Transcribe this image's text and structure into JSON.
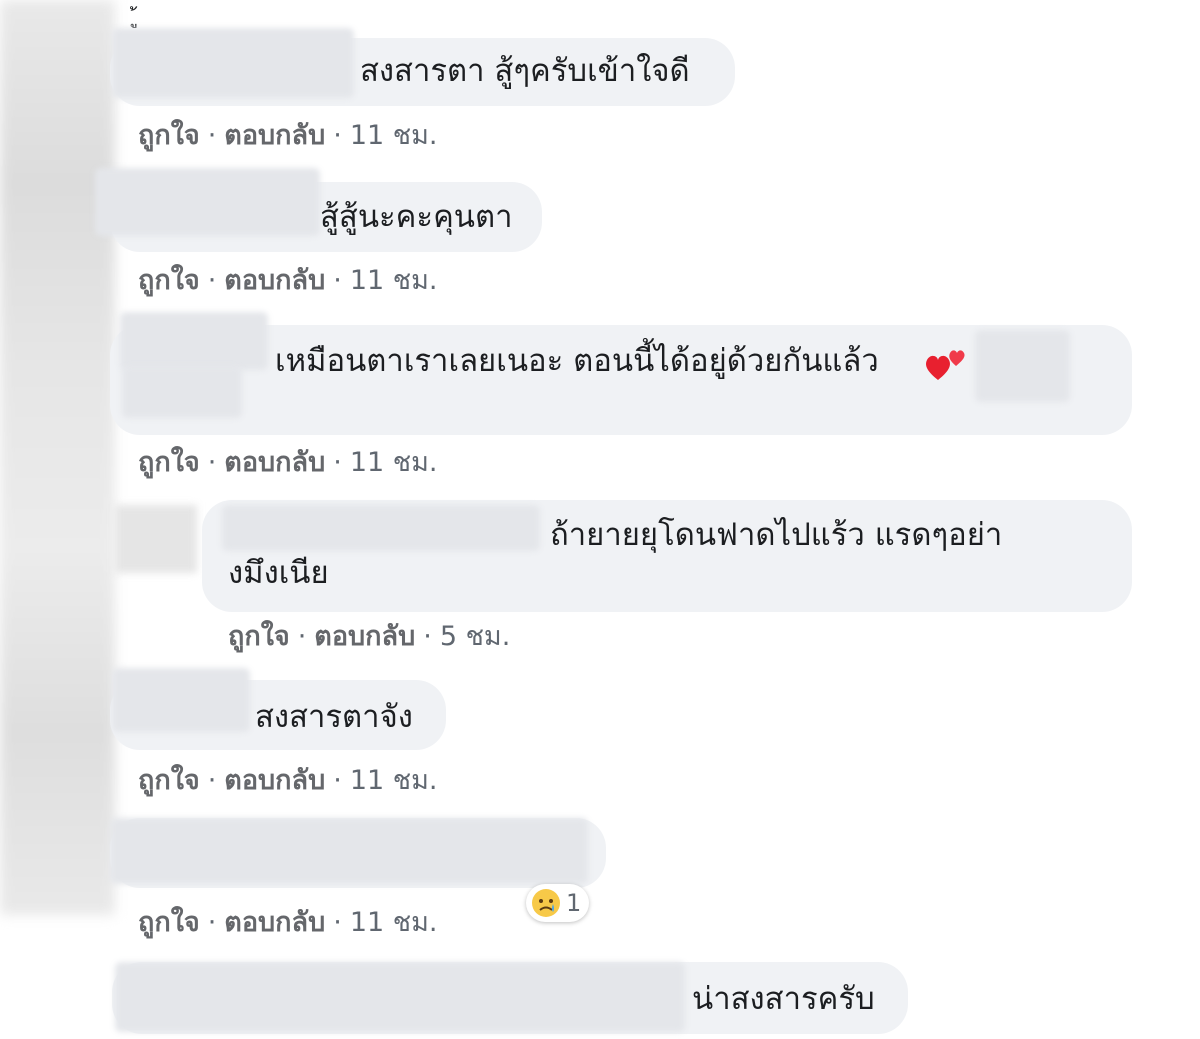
{
  "partial_top_glyph": "ู้",
  "comments": [
    {
      "text": "สงสารตา สู้ๆครับเข้าใจดี",
      "actions": {
        "like": "ถูกใจ",
        "reply": "ตอบกลับ",
        "time": "11 ชม."
      }
    },
    {
      "text": "สู้สู้นะคะคุนตา",
      "actions": {
        "like": "ถูกใจ",
        "reply": "ตอบกลับ",
        "time": "11 ชม."
      }
    },
    {
      "text": "เหมือนตาเราเลยเนอะ ตอนนี้ได้อยู่ด้วยกันแล้ว",
      "emoji": "two-hearts",
      "actions": {
        "like": "ถูกใจ",
        "reply": "ตอบกลับ",
        "time": "11 ชม."
      }
    },
    {
      "text_line1": "ถ้ายายยุโดนฟาดไปแร้ว แรดๆอย่า",
      "text_line2": "งมึงเนีย",
      "actions": {
        "like": "ถูกใจ",
        "reply": "ตอบกลับ",
        "time": "5 ชม."
      }
    },
    {
      "text": "สงสารตาจัง",
      "actions": {
        "like": "ถูกใจ",
        "reply": "ตอบกลับ",
        "time": "11 ชม."
      }
    },
    {
      "text": "",
      "reaction": {
        "icon": "sad-face-icon",
        "count": "1"
      },
      "actions": {
        "like": "ถูกใจ",
        "reply": "ตอบกลับ",
        "time": "11 ชม."
      }
    },
    {
      "text": "น่าสงสารครับ"
    }
  ],
  "colors": {
    "bubble": "#f0f2f5",
    "meta_text": "#606770",
    "text": "#1c1e21"
  }
}
